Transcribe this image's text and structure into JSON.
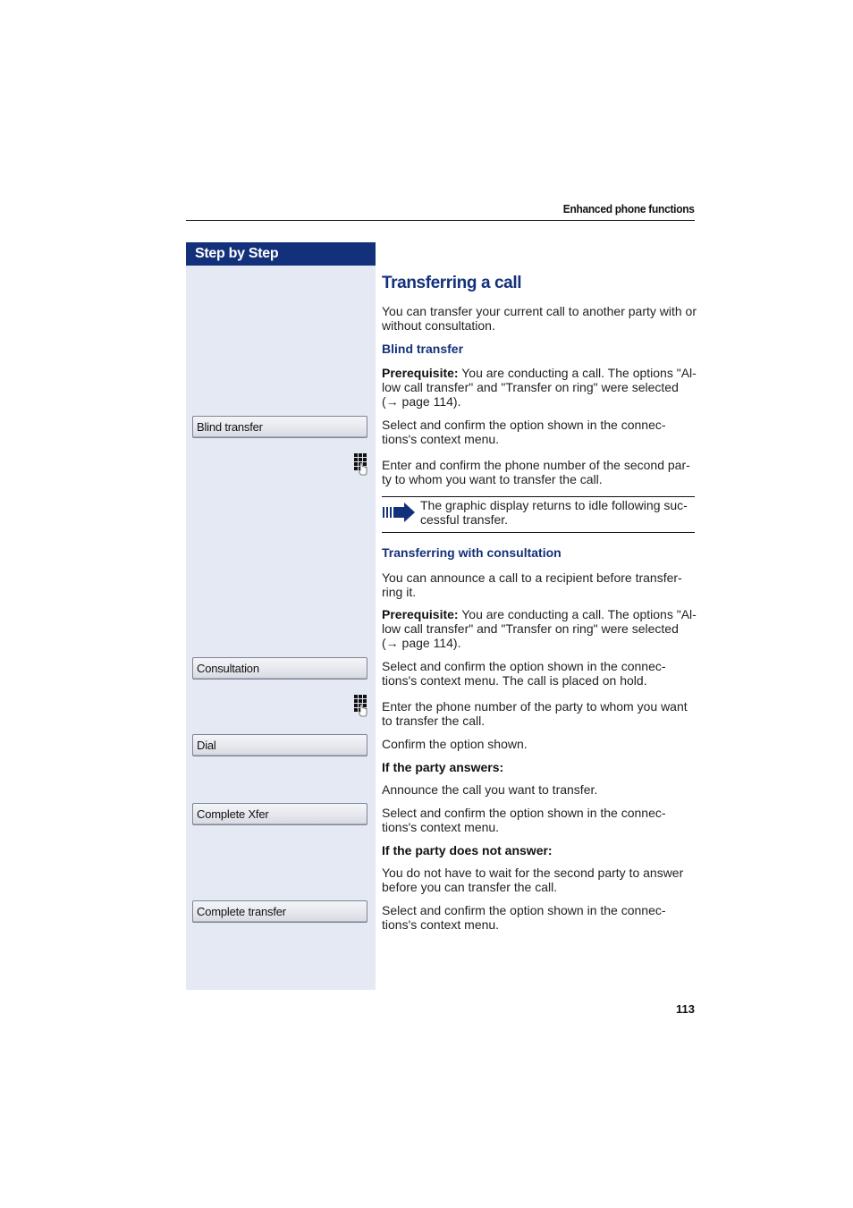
{
  "header": {
    "section_title": "Enhanced phone functions"
  },
  "sidebar": {
    "title": "Step by Step",
    "softkeys": [
      {
        "label": "Blind transfer"
      },
      {
        "label": "Consultation"
      },
      {
        "label": "Dial"
      },
      {
        "label": "Complete Xfer"
      },
      {
        "label": "Complete transfer"
      }
    ],
    "icons": [
      "keypad-icon",
      "keypad-icon"
    ]
  },
  "main": {
    "title": "Transferring a call",
    "intro": "You can transfer your current call to another party with or without consultation.",
    "blind": {
      "heading": "Blind transfer",
      "prereq_label": "Prerequisite:",
      "prereq_text": " You are conducting a call. The options \"Al-low call transfer\" and \"Transfer on ring\" were selected (→ page 114).",
      "step1": "Select and confirm the option shown in the connec-tions's context menu.",
      "step2": "Enter and confirm the phone number of the second par-ty to whom you want to transfer the call.",
      "note": "The graphic display returns to idle following suc-cessful transfer."
    },
    "consult": {
      "heading": "Transferring with consultation",
      "intro": "You can announce a call to a recipient before transfer-ring it.",
      "prereq_label": "Prerequisite:",
      "prereq_text": " You are conducting a call. The options \"Al-low call transfer\" and \"Transfer on ring\" were selected (→ page 114).",
      "step1": "Select and confirm the option shown in the connec-tions's context menu. The call is placed on hold.",
      "step2": "Enter the phone number of the party to whom you want to transfer the call.",
      "step3": "Confirm the option shown.",
      "answers_heading": "If the party answers:",
      "answers_step1": "Announce the call you want to transfer.",
      "answers_step2": "Select and confirm the option shown in the connec-tions's context menu.",
      "noanswer_heading": "If the party does not answer:",
      "noanswer_step1": "You do not have to wait for the second party to answer before you can transfer the call.",
      "noanswer_step2": "Select and confirm the option shown in the connec-tions's context menu."
    }
  },
  "footer": {
    "page_number": "113"
  },
  "colors": {
    "accent": "#13307a",
    "sidebar_bg": "#e5e9f3"
  }
}
